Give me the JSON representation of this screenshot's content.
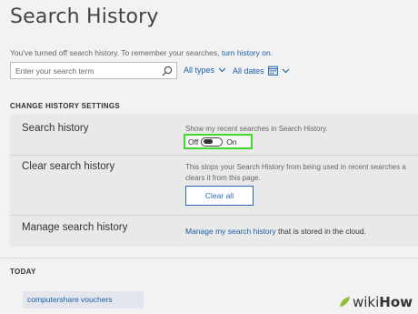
{
  "header": {
    "title": "Search History",
    "notice_text": "You've turned off search history.  To remember your searches, ",
    "notice_link": "turn history on",
    "notice_end": "."
  },
  "search": {
    "placeholder": "Enter your search term",
    "value": ""
  },
  "filters": {
    "types_label": "All types",
    "dates_label": "All dates"
  },
  "settings": {
    "section_title": "CHANGE HISTORY SETTINGS",
    "search_history": {
      "label": "Search history",
      "description": "Show my recent searches in Search History.",
      "toggle_off_label": "Off",
      "toggle_on_label": "On",
      "state": "off"
    },
    "clear_history": {
      "label": "Clear search history",
      "description_line1": "This stops your Search History from being used in recent searches a",
      "description_line2": "clears it from this page.",
      "button_label": "Clear all"
    },
    "manage_history": {
      "label": "Manage search history",
      "link_text": "Manage my search history",
      "rest_text": " that is stored in the cloud."
    }
  },
  "today": {
    "section_title": "TODAY",
    "entries": [
      {
        "query": "computershare vouchers"
      }
    ]
  },
  "watermark": {
    "wiki": "wiki",
    "how": "How"
  },
  "colors": {
    "link": "#1a5fa8",
    "highlight": "#43d82d",
    "panel": "#e9e9e9",
    "background": "#f2f2f2"
  }
}
